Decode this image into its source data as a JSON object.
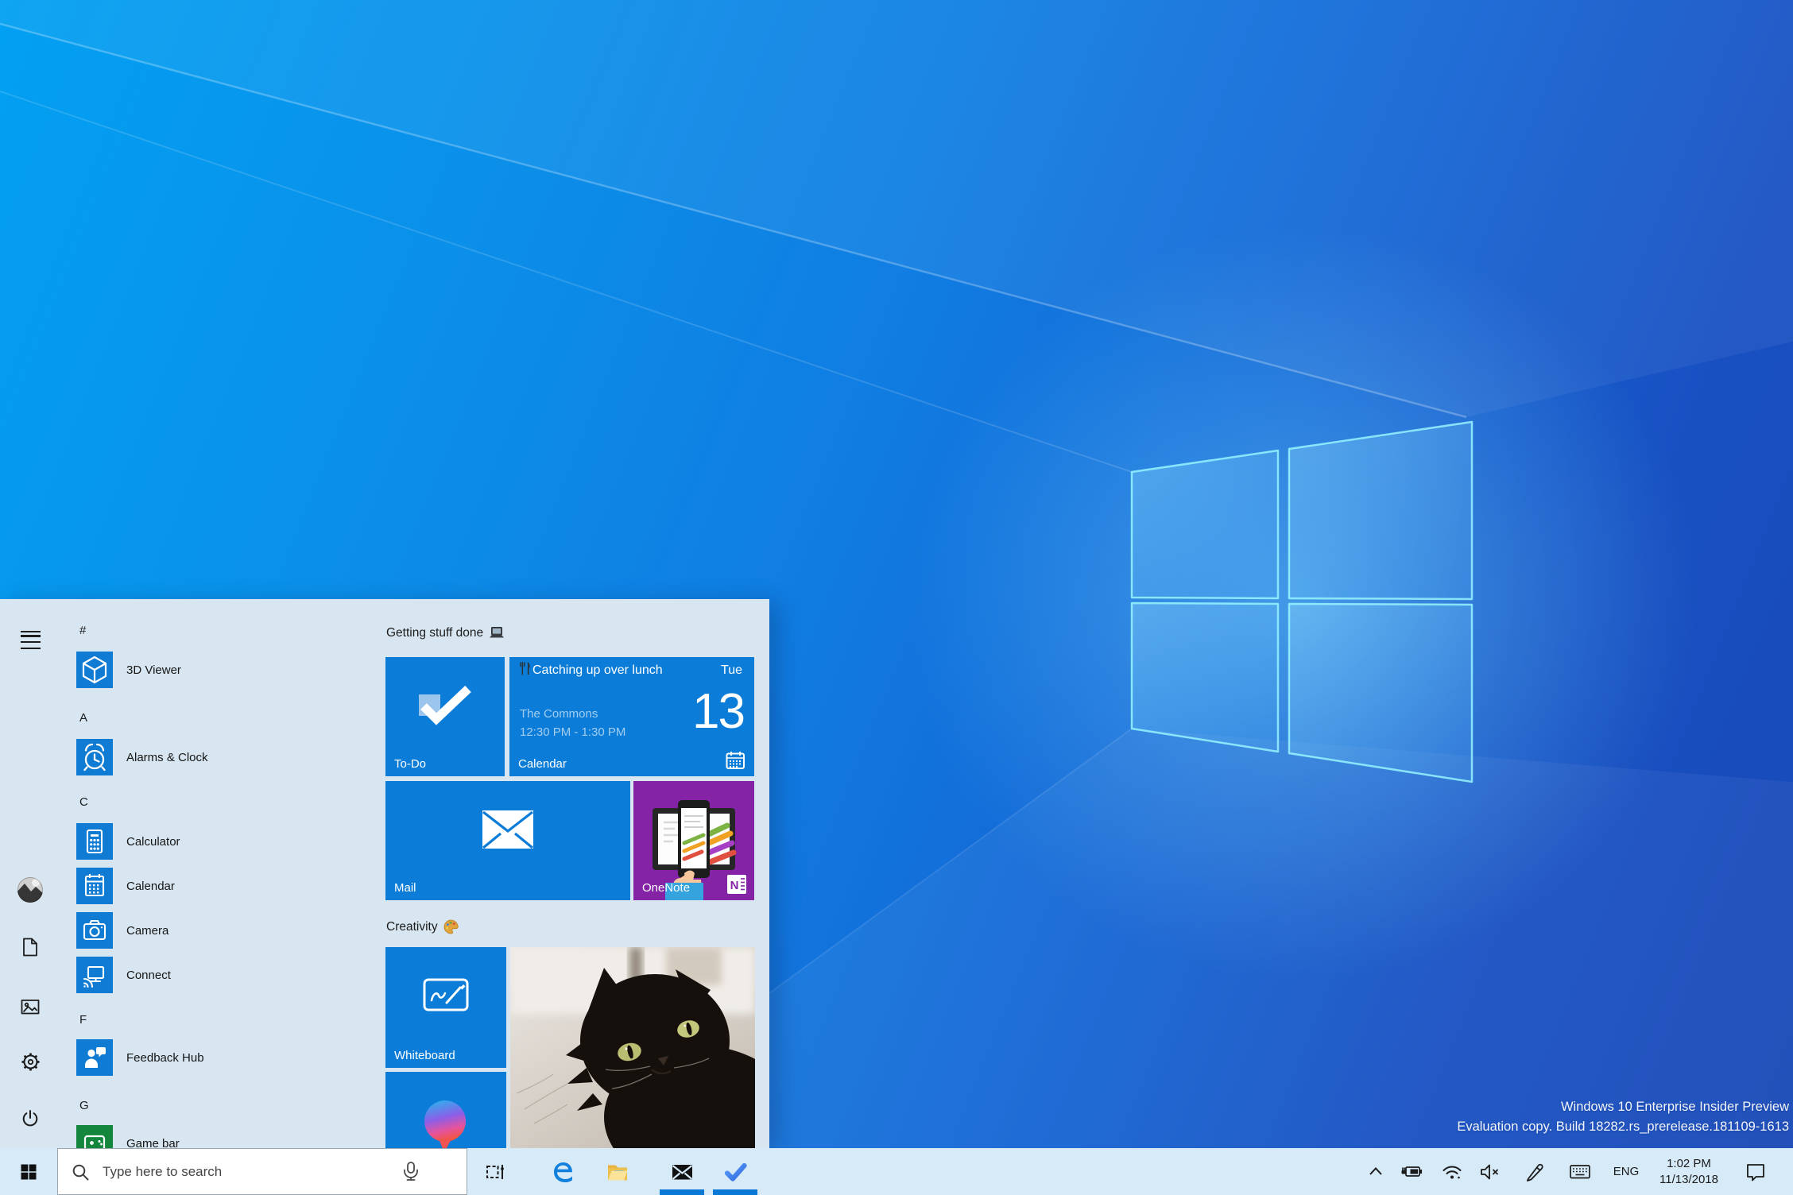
{
  "desktop": {
    "watermark_line1": "Windows 10 Enterprise Insider Preview",
    "watermark_line2": "Evaluation copy. Build 18282.rs_prerelease.181109-1613",
    "wallpaper": "windows-10-light-logo"
  },
  "start_menu": {
    "rail_icons": [
      "hamburger-menu",
      "user-avatar",
      "documents",
      "pictures",
      "settings",
      "power"
    ],
    "app_sections": [
      {
        "header": "#",
        "apps": [
          {
            "label": "3D Viewer",
            "icon": "3d-viewer"
          }
        ]
      },
      {
        "header": "A",
        "apps": [
          {
            "label": "Alarms & Clock",
            "icon": "alarm-clock"
          }
        ]
      },
      {
        "header": "C",
        "apps": [
          {
            "label": "Calculator",
            "icon": "calculator"
          },
          {
            "label": "Calendar",
            "icon": "calendar"
          },
          {
            "label": "Camera",
            "icon": "camera"
          },
          {
            "label": "Connect",
            "icon": "connect"
          }
        ]
      },
      {
        "header": "F",
        "apps": [
          {
            "label": "Feedback Hub",
            "icon": "feedback-hub"
          }
        ]
      },
      {
        "header": "G",
        "apps": [
          {
            "label": "Game bar",
            "icon": "game-bar"
          }
        ]
      }
    ],
    "groups": [
      {
        "title": "Getting stuff done",
        "emoji": "laptop"
      },
      {
        "title": "Creativity",
        "emoji": "palette"
      }
    ],
    "tiles": {
      "todo": {
        "label": "To-Do"
      },
      "calendar": {
        "label": "Calendar",
        "event_icon": "fork-and-knife",
        "event_title": "Catching up over lunch",
        "event_location": "The Commons",
        "event_time": "12:30 PM - 1:30 PM",
        "day_abbrev": "Tue",
        "day_number": "13"
      },
      "mail": {
        "label": "Mail"
      },
      "onenote": {
        "label": "OneNote"
      },
      "whiteboard": {
        "label": "Whiteboard"
      },
      "photos": {
        "content": "black-cat-photo"
      },
      "cortana": {
        "content": "cortana-balloon"
      }
    }
  },
  "taskbar": {
    "search_placeholder": "Type here to search",
    "search_icons": [
      "search-magnifier",
      "microphone"
    ],
    "app_icons": [
      "task-view",
      "edge",
      "file-explorer",
      "mail",
      "to-do"
    ],
    "running_apps": [
      "mail",
      "to-do"
    ],
    "tray_icons": [
      "chevron-up",
      "battery-charging",
      "wifi",
      "volume-muted",
      "pen",
      "touch-keyboard",
      "action-center"
    ],
    "language": "ENG",
    "time": "1:02 PM",
    "date": "11/13/2018"
  },
  "colors": {
    "accent_blue": "#0b7cd7",
    "onenote_purple": "#8423a5",
    "gamebar_green": "#15873c",
    "menu_bg": "#d7e6f0",
    "taskbar_bg": "#d6eaf8",
    "running_indicator": "#0a78d6"
  }
}
